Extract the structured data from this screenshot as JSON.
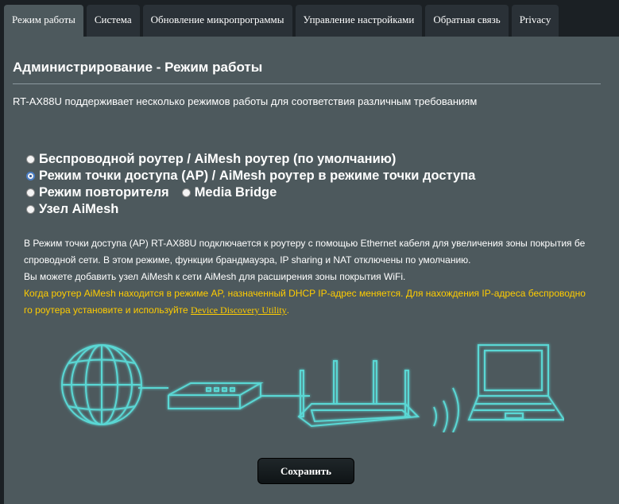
{
  "tabs": [
    {
      "label": "Режим работы",
      "active": true
    },
    {
      "label": "Система",
      "active": false
    },
    {
      "label": "Обновление микропрограммы",
      "active": false
    },
    {
      "label": "Управление настройками",
      "active": false
    },
    {
      "label": "Обратная связь",
      "active": false
    },
    {
      "label": "Privacy",
      "active": false
    }
  ],
  "page": {
    "title": "Администрирование - Режим работы",
    "description": "RT-AX88U поддерживает несколько режимов работы для соответствия различным требованиям"
  },
  "modes": {
    "wireless_router": "Беспроводной роутер / AiMesh роутер (по умолчанию)",
    "access_point": "Режим точки доступа (AP) / AiMesh роутер в режиме точки доступа",
    "repeater": "Режим повторителя",
    "media_bridge": "Media Bridge",
    "aimesh_node": "Узел AiMesh",
    "selected": "access_point"
  },
  "info": {
    "line1": "В Режим точки доступа (AP) RT-AX88U подключается к роутеру с помощью Ethernet кабеля для увеличения зоны покрытия бе",
    "line2": "спроводной сети. В этом режиме, функции брандмауэра, IP sharing и NAT отключены по умолчанию.",
    "line3": "Вы можете добавить узел AiMesh к сети AiMesh для расширения зоны покрытия WiFi.",
    "warning_line1": "Когда роутер AiMesh находится в режиме AP, назначенный DHCP IP-адрес меняется. Для нахождения IP-адреса беспроводно",
    "warning_line2": "го роутера установите и используйте ",
    "link": "Device Discovery Utility",
    "warning_end": "."
  },
  "diagram": {
    "icons": [
      "globe-icon",
      "modem-icon",
      "router-icon",
      "wifi-waves-icon",
      "laptop-icon"
    ],
    "line_color": "#5ad7d4",
    "glow_color": "#2a8f96"
  },
  "buttons": {
    "save": "Сохранить"
  },
  "colors": {
    "panel_bg": "#4d595d",
    "page_bg": "#1b2024",
    "warning_text": "#ffcc00"
  }
}
